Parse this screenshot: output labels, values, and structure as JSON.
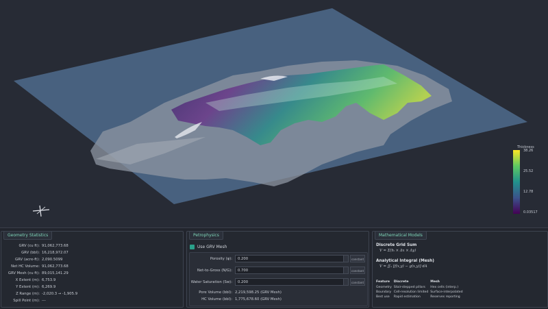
{
  "colorbar": {
    "title": "Thickness",
    "ticks": [
      "38.26",
      "25.52",
      "12.78",
      "0.03517"
    ]
  },
  "geometry": {
    "title": "Geometry Statistics",
    "stats": [
      {
        "label": "GRV (cu ft):",
        "value": "91,062,773.68"
      },
      {
        "label": "GRV (bbl):",
        "value": "16,218,972.07"
      },
      {
        "label": "GRV (acre-ft):",
        "value": "2,090.5099"
      },
      {
        "label": "Net HC Volume:",
        "value": "91,062,773.68"
      },
      {
        "label": "GRV Mesh (cu ft):",
        "value": "89,015,141.29"
      },
      {
        "label": "X Extent (m):",
        "value": "6,753.9"
      },
      {
        "label": "Y Extent (m):",
        "value": "6,269.9"
      },
      {
        "label": "Z Range (m):",
        "value": "-2,020.3 → -1,905.9"
      },
      {
        "label": "Spill Point (m):",
        "value": "---"
      }
    ]
  },
  "petro": {
    "title": "Petrophysics",
    "use_mesh_label": "Use GRV Mesh",
    "fields": [
      {
        "label": "Porosity (φ):",
        "value": "0.200",
        "button": "constant"
      },
      {
        "label": "Net-to-Gross (N/G):",
        "value": "0.700",
        "button": "constant"
      },
      {
        "label": "Water Saturation (Sw):",
        "value": "0.200",
        "button": "constant"
      }
    ],
    "pore_label": "Pore Volume (bbl):",
    "pore_value": "2,219,598.25 (GRV Mesh)",
    "hc_label": "HC Volume (bbl):",
    "hc_value": "1,775,678.60 (GRV Mesh)"
  },
  "math": {
    "title": "Mathematical Models",
    "h1": "Discrete Grid Sum",
    "f1": "V = Σ(hᵢ × Δx × Δy)",
    "h2": "Analytical Integral (Mesh)",
    "f2": "V = ∬ₐ [f(x,y) − g(x,y)] dA",
    "table": {
      "headers": [
        "Feature",
        "Discrete",
        "Mesh"
      ],
      "rows": [
        [
          "Geometry",
          "Stair-stepped pillars",
          "Hex cells (interp.)"
        ],
        [
          "Boundary",
          "Cell-resolution limited",
          "Surface-interpolated"
        ],
        [
          "Best use",
          "Rapid estimation",
          "Reserves reporting"
        ]
      ]
    }
  }
}
